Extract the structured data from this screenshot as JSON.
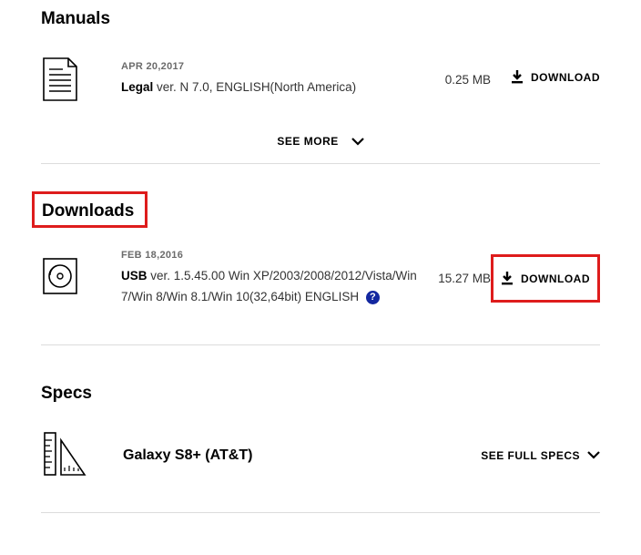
{
  "manuals": {
    "title": "Manuals",
    "item": {
      "date": "APR 20,2017",
      "name": "Legal",
      "details": " ver. N 7.0, ENGLISH(North America)",
      "size": "0.25 MB",
      "download_label": "DOWNLOAD"
    },
    "see_more": "SEE MORE"
  },
  "downloads": {
    "title": "Downloads",
    "item": {
      "date": "FEB 18,2016",
      "name": "USB",
      "details": " ver. 1.5.45.00 Win XP/2003/2008/2012/Vista/Win 7/Win 8/Win 8.1/Win 10(32,64bit) ENGLISH",
      "size": "15.27 MB",
      "download_label": "DOWNLOAD",
      "help": "?"
    }
  },
  "specs": {
    "title": "Specs",
    "name": "Galaxy S8+ (AT&T)",
    "see_full": "SEE FULL SPECS"
  }
}
